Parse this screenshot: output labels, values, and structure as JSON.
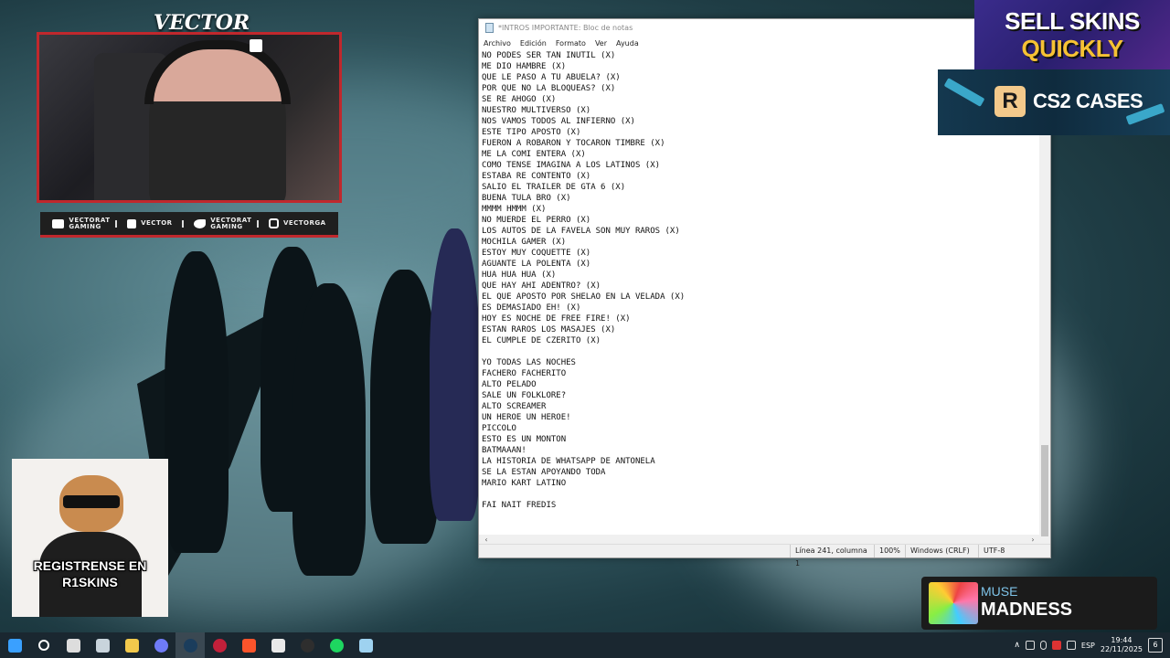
{
  "overlay": {
    "cam_title": "VECTOR",
    "socials": [
      {
        "icon": "youtube-icon",
        "label": "VECTORAT GAMING"
      },
      {
        "icon": "twitch-icon",
        "label": "VECTOR"
      },
      {
        "icon": "twitter-icon",
        "label": "VECTORAT GAMING"
      },
      {
        "icon": "instagram-icon",
        "label": "VECTORGA"
      }
    ],
    "cat_caption_line1": "REGISTRENSE EN",
    "cat_caption_line2": "R1SKINS",
    "promo_sell_line1": "SELL SKINS",
    "promo_sell_line2": "QUICKLY",
    "promo_cases_logo": "R",
    "promo_cases_text": "CS2 CASES",
    "now_playing": {
      "artist": "MUSE",
      "track": "MADNESS"
    }
  },
  "notepad": {
    "title": "*INTROS IMPORTANTE: Bloc de notas",
    "menu": [
      "Archivo",
      "Edición",
      "Formato",
      "Ver",
      "Ayuda"
    ],
    "lines": [
      "NO PODES SER TAN INUTIL (X)",
      "ME DIO HAMBRE (X)",
      "QUE LE PASO A TU ABUELA? (X)",
      "POR QUE NO LA BLOQUEAS? (X)",
      "SE RE AHOGO (X)",
      "NUESTRO MULTIVERSO (X)",
      "NOS VAMOS TODOS AL INFIERNO (X)",
      "ESTE TIPO APOSTO (X)",
      "FUERON A ROBARON Y TOCARON TIMBRE (X)",
      "ME LA COMI ENTERA (X)",
      "COMO TENSE IMAGINA A LOS LATINOS (X)",
      "ESTABA RE CONTENTO (X)",
      "SALIO EL TRAILER DE GTA 6 (X)",
      "BUENA TULA BRO (X)",
      "MMMM HMMM (X)",
      "NO MUERDE EL PERRO (X)",
      "LOS AUTOS DE LA FAVELA SON MUY RAROS (X)",
      "MOCHILA GAMER (X)",
      "ESTOY MUY COQUETTE (X)",
      "AGUANTE LA POLENTA (X)",
      "HUA HUA HUA (X)",
      "QUE HAY AHI ADENTRO? (X)",
      "EL QUE APOSTO POR SHELAO EN LA VELADA (X)",
      "ES DEMASIADO EH! (X)",
      "HOY ES NOCHE DE FREE FIRE! (X)",
      "ESTAN RAROS LOS MASAJES (X)",
      "EL CUMPLE DE CZERITO (X)",
      "",
      "YO TODAS LAS NOCHES",
      "FACHERO FACHERITO",
      "ALTO PELADO",
      "SALE UN FOLKLORE?",
      "ALTO SCREAMER",
      "UN HEROE UN HEROE!",
      "PICCOLO",
      "ESTO ES UN MONTON",
      "BATMAAAN!",
      "LA HISTORIA DE WHATSAPP DE ANTONELA",
      "SE LA ESTAN APOYANDO TODA",
      "MARIO KART LATINO",
      "",
      "FAI NAIT FREDIS"
    ],
    "status": {
      "position": "Línea 241, columna 1",
      "zoom": "100%",
      "line_ending": "Windows (CRLF)",
      "encoding": "UTF-8"
    }
  },
  "taskbar": {
    "apps": [
      {
        "icon": "windows-start-icon",
        "color": "#3aa0ff"
      },
      {
        "icon": "search-icon",
        "color": "#ffffff"
      },
      {
        "icon": "task-view-icon",
        "color": "#dddddd"
      },
      {
        "icon": "explorer-icon",
        "color": "#c9d4dc"
      },
      {
        "icon": "folder-icon",
        "color": "#f2c94c"
      },
      {
        "icon": "discord-icon",
        "color": "#6f7bf7"
      },
      {
        "icon": "steam-icon",
        "color": "#1b3d5c"
      },
      {
        "icon": "opera-gx-icon",
        "color": "#c2203a"
      },
      {
        "icon": "brave-icon",
        "color": "#fb542b"
      },
      {
        "icon": "cs2-icon",
        "color": "#e9e9e9"
      },
      {
        "icon": "obs-icon",
        "color": "#2e2e2e"
      },
      {
        "icon": "spotify-icon",
        "color": "#1ed760"
      },
      {
        "icon": "notepad-icon",
        "color": "#9ed2f0"
      }
    ],
    "language": "ESP",
    "time": "19:44",
    "date": "22/11/2025",
    "notifications": "6"
  }
}
